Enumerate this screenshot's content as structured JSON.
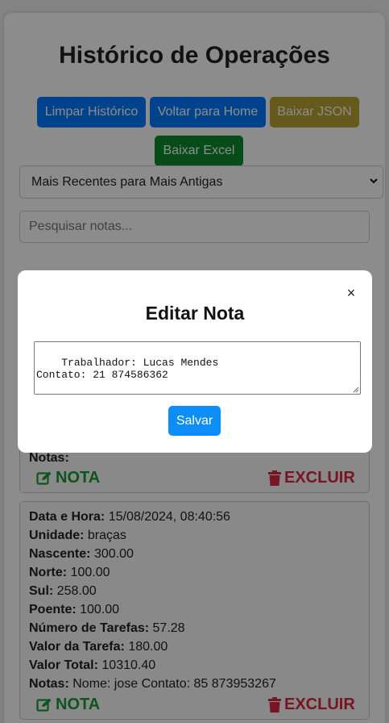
{
  "page": {
    "title": "Histórico de Operações"
  },
  "toolbar": {
    "clear_label": "Limpar Histórico",
    "home_label": "Voltar para Home",
    "json_label": "Baixar JSON",
    "excel_label": "Baixar Excel"
  },
  "sort": {
    "selected": "Mais Recentes para Mais Antigas"
  },
  "search": {
    "placeholder": "Pesquisar notas..."
  },
  "records": [
    {
      "notas_label": "Notas:",
      "notas_value": "",
      "note_action": "NOTA",
      "delete_action": "EXCLUIR"
    },
    {
      "fields": [
        {
          "label": "Data e Hora:",
          "value": "15/08/2024, 08:40:56"
        },
        {
          "label": "Unidade:",
          "value": "braças"
        },
        {
          "label": "Nascente:",
          "value": "300.00"
        },
        {
          "label": "Norte:",
          "value": "100.00"
        },
        {
          "label": "Sul:",
          "value": "258.00"
        },
        {
          "label": "Poente:",
          "value": "100.00"
        },
        {
          "label": "Número de Tarefas:",
          "value": "57.28"
        },
        {
          "label": "Valor da Tarefa:",
          "value": "180.00"
        },
        {
          "label": "Valor Total:",
          "value": "10310.40"
        },
        {
          "label": "Notas:",
          "value": "Nome: jose Contato: 85 873953267"
        }
      ],
      "note_action": "NOTA",
      "delete_action": "EXCLUIR"
    }
  ],
  "modal": {
    "title": "Editar Nota",
    "close_symbol": "×",
    "textarea_value": "Trabalhador: Lucas Mendes\nContato: 21 874586362",
    "save_label": "Salvar"
  },
  "colors": {
    "primary": "#007bff",
    "json_button": "#b9a234",
    "excel_button": "#0b8a2e",
    "note_action": "#1a9a3a",
    "delete_action": "#d9273e",
    "save_button": "#0d8df7"
  }
}
